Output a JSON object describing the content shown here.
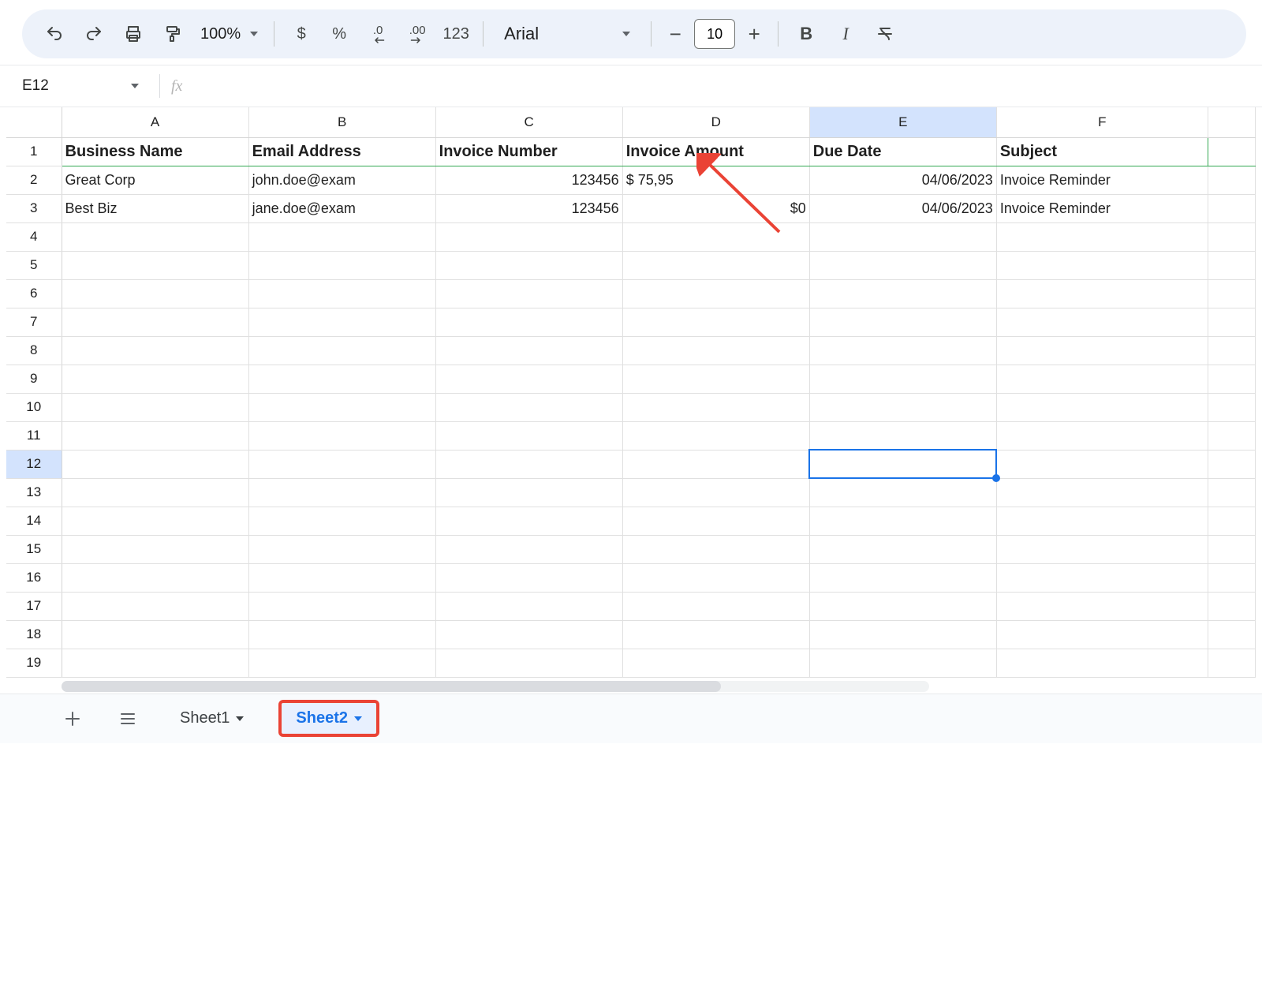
{
  "toolbar": {
    "zoom_label": "100%",
    "font_name": "Arial",
    "font_size": "10",
    "currency_label": "$",
    "percent_label": "%",
    "dec_dec_label": ".0",
    "inc_dec_label": ".00",
    "numfmt_label": "123",
    "bold_label": "B",
    "italic_label": "I"
  },
  "name_box": "E12",
  "formula": "",
  "columns": [
    "A",
    "B",
    "C",
    "D",
    "E",
    "F"
  ],
  "selected_column_index": 4,
  "selected_row_index": 11,
  "row_count": 19,
  "headers": [
    "Business Name",
    "Email Address",
    "Invoice Number",
    "Invoice Amount",
    "Due Date",
    "Subject"
  ],
  "rows": [
    {
      "A": "Great Corp",
      "B": "john.doe@exam",
      "C": "123456",
      "D": "$ 75,95",
      "E": "04/06/2023",
      "F": "Invoice Reminder"
    },
    {
      "A": "Best Biz",
      "B": "jane.doe@exam",
      "C": "123456",
      "D": "$0",
      "E": "04/06/2023",
      "F": "Invoice Reminder"
    }
  ],
  "sheets": {
    "tab1": "Sheet1",
    "tab2": "Sheet2",
    "active": 1
  },
  "colors": {
    "selection": "#1a73e8",
    "annotation_red": "#ea4335",
    "header_green": "#34a853"
  }
}
